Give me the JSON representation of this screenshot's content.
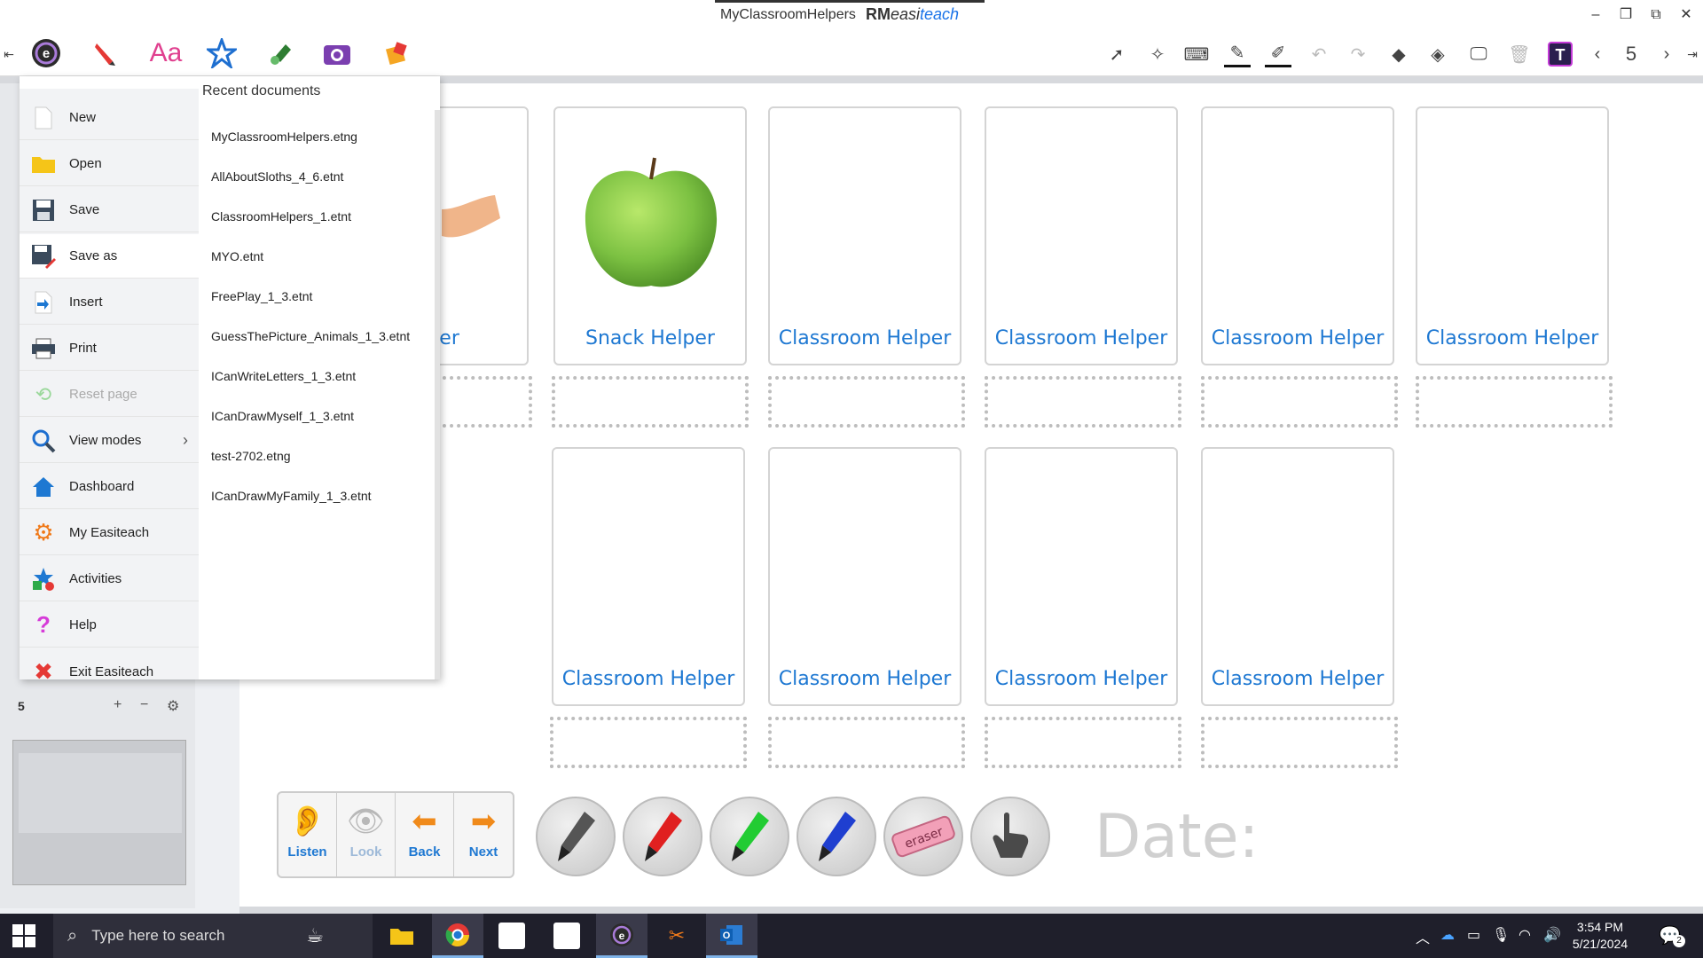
{
  "window": {
    "title": "MyClassroomHelpers",
    "brand_prefix": "RM",
    "brand_main": "easi",
    "brand_accent": "teach",
    "controls": [
      "–",
      "❐",
      "⧉",
      "✕"
    ]
  },
  "toolbar": {
    "left_tools": [
      "easiteach-menu-icon",
      "pen-icon",
      "text-icon",
      "star-icon",
      "paint-icon",
      "camera-icon",
      "shape-icon"
    ],
    "text_tool_label": "Aa",
    "page_indicator": "5"
  },
  "left_panel": {
    "page_number": "5",
    "add_label": "+",
    "remove_label": "−",
    "settings_label": "⚙"
  },
  "file_menu": {
    "items": [
      {
        "label": "New",
        "icon": "new-document-icon",
        "state": "normal"
      },
      {
        "label": "Open",
        "icon": "folder-icon",
        "state": "normal"
      },
      {
        "label": "Save",
        "icon": "save-icon",
        "state": "normal"
      },
      {
        "label": "Save as",
        "icon": "save-as-icon",
        "state": "active"
      },
      {
        "label": "Insert",
        "icon": "insert-icon",
        "state": "normal"
      },
      {
        "label": "Print",
        "icon": "printer-icon",
        "state": "normal"
      },
      {
        "label": "Reset page",
        "icon": "reset-icon",
        "state": "disabled"
      },
      {
        "label": "View modes",
        "icon": "magnifier-icon",
        "state": "submenu"
      },
      {
        "label": "Dashboard",
        "icon": "home-icon",
        "state": "normal"
      },
      {
        "label": "My Easiteach",
        "icon": "gear-icon",
        "state": "normal"
      },
      {
        "label": "Activities",
        "icon": "activities-icon",
        "state": "normal"
      },
      {
        "label": "Help",
        "icon": "help-icon",
        "state": "normal"
      },
      {
        "label": "Exit Easiteach",
        "icon": "exit-icon",
        "state": "normal"
      }
    ],
    "recent_title": "Recent documents",
    "recent": [
      "MyClassroomHelpers.etng",
      "AllAboutSloths_4_6.etnt",
      "ClassroomHelpers_1.etnt",
      "MYO.etnt",
      "FreePlay_1_3.etnt",
      "GuessThePicture_Animals_1_3.etnt",
      "ICanWriteLetters_1_3.etnt",
      "ICanDrawMyself_1_3.etnt",
      "test-2702.etng",
      "ICanDrawMyFamily_1_3.etnt"
    ]
  },
  "cards": {
    "row1": [
      "Greeter",
      "Snack Helper",
      "Classroom Helper",
      "Classroom Helper",
      "Classroom Helper",
      "Classroom Helper"
    ],
    "row2": [
      "Classroom Helper",
      "Classroom Helper",
      "Classroom Helper",
      "Classroom Helper"
    ]
  },
  "nav_tools": {
    "listen": "Listen",
    "look": "Look",
    "back": "Back",
    "next": "Next"
  },
  "pens": [
    {
      "name": "black-marker",
      "color": "#555555"
    },
    {
      "name": "red-marker",
      "color": "#e02020"
    },
    {
      "name": "green-marker",
      "color": "#22cc33"
    },
    {
      "name": "blue-marker",
      "color": "#1f3fd0"
    }
  ],
  "eraser_label": "eraser",
  "date_label": "Date:",
  "taskbar": {
    "search_placeholder": "Type here to search",
    "time": "3:54 PM",
    "date": "5/21/2024",
    "notification_count": "2"
  }
}
